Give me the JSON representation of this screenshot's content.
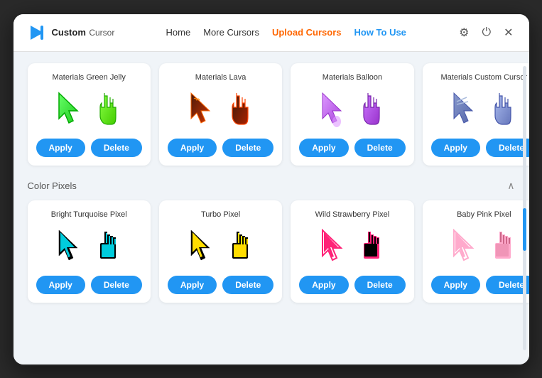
{
  "app": {
    "title": "Custom Cursor",
    "subtitle": "Cursor"
  },
  "nav": {
    "home": "Home",
    "more": "More Cursors",
    "upload": "Upload Cursors",
    "howto": "How To Use"
  },
  "sections": [
    {
      "id": "materials",
      "title": "",
      "collapsed": false,
      "items": [
        {
          "id": "green-jelly",
          "name": "Materials Green Jelly",
          "color1": "#4cdb4c",
          "color2": "#88ff55"
        },
        {
          "id": "lava",
          "name": "Materials Lava",
          "color1": "#3a1a0a",
          "color2": "#8b2800"
        },
        {
          "id": "balloon",
          "name": "Materials Balloon",
          "color1": "#cc88ff",
          "color2": "#aa66dd"
        },
        {
          "id": "custom-cursor",
          "name": "Materials Custom Cursor",
          "color1": "#8899cc",
          "color2": "#aabbdd"
        }
      ]
    },
    {
      "id": "color-pixels",
      "title": "Color Pixels",
      "collapsed": false,
      "items": [
        {
          "id": "bright-turquoise",
          "name": "Bright Turquoise Pixel",
          "color1": "#00ccdd",
          "color2": "#00bbcc"
        },
        {
          "id": "turbo",
          "name": "Turbo Pixel",
          "color1": "#ffdd00",
          "color2": "#ffcc00"
        },
        {
          "id": "wild-strawberry",
          "name": "Wild Strawberry Pixel",
          "color1": "#ff2277",
          "color2": "#ff1166"
        },
        {
          "id": "baby-pink",
          "name": "Baby Pink Pixel",
          "color1": "#ffaacc",
          "color2": "#ff99bb"
        }
      ]
    }
  ],
  "buttons": {
    "apply": "Apply",
    "delete": "Delete"
  }
}
